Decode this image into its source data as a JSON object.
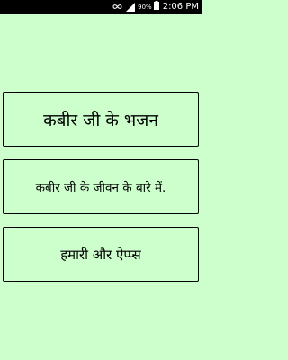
{
  "status_bar": {
    "battery_percent": "90%",
    "time": "2:06 PM",
    "icons": [
      "infinity-icon",
      "signal-bars-icon",
      "battery-icon"
    ],
    "battery_color": "#ffffff"
  },
  "menu": {
    "items": [
      {
        "label": "कबीर जी के भजन"
      },
      {
        "label": "कबीर जी के जीवन के बारे में."
      },
      {
        "label": "हमारी और ऐप्प्स"
      }
    ]
  },
  "colors": {
    "background": "#ccffcc",
    "status_bar": "#000000",
    "border": "#000000",
    "text": "#000000"
  }
}
